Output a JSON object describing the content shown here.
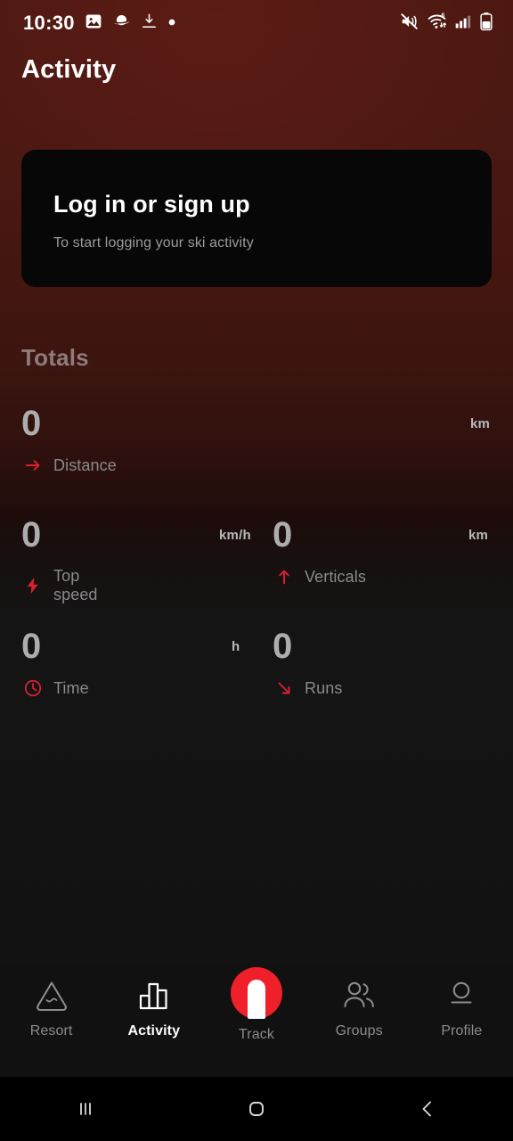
{
  "statusbar": {
    "time": "10:30",
    "battery_percent": "53%",
    "left_icons": [
      "image-icon",
      "planet-icon",
      "download-icon",
      "dot-icon"
    ],
    "right_icons": [
      "mute-icon",
      "wifi-6-icon",
      "signal-bars-icon",
      "battery-icon"
    ]
  },
  "header": {
    "title": "Activity"
  },
  "login_card": {
    "title": "Log in or sign up",
    "subtitle": "To start logging your ski activity"
  },
  "totals": {
    "heading": "Totals",
    "stats": [
      {
        "value": "0",
        "unit": "km",
        "label": "Distance",
        "icon": "arrow-right-icon"
      },
      {
        "value": "0",
        "unit": "km/h",
        "label": "Top speed",
        "icon": "lightning-bolt-icon"
      },
      {
        "value": "0",
        "unit": "km",
        "label": "Verticals",
        "icon": "arrow-up-icon"
      },
      {
        "value": "0",
        "unit": "h",
        "label": "Time",
        "icon": "clock-icon"
      },
      {
        "value": "0",
        "unit": "",
        "label": "Runs",
        "icon": "arrow-down-right-icon"
      }
    ]
  },
  "bottom_nav": {
    "items": [
      {
        "label": "Resort",
        "icon": "mountain-icon",
        "active": false
      },
      {
        "label": "Activity",
        "icon": "bar-chart-icon",
        "active": true
      },
      {
        "label": "Track",
        "icon": "track-icon",
        "active": false
      },
      {
        "label": "Groups",
        "icon": "people-icon",
        "active": false
      },
      {
        "label": "Profile",
        "icon": "person-icon",
        "active": false
      }
    ]
  },
  "android_nav": {
    "recents_label": "recent-apps",
    "home_label": "home",
    "back_label": "back"
  },
  "colors": {
    "accent_red": "#dc2030",
    "track_red": "#f0202a",
    "background_top": "#4a1812",
    "background_bottom": "#121212",
    "card_background": "#070707"
  }
}
